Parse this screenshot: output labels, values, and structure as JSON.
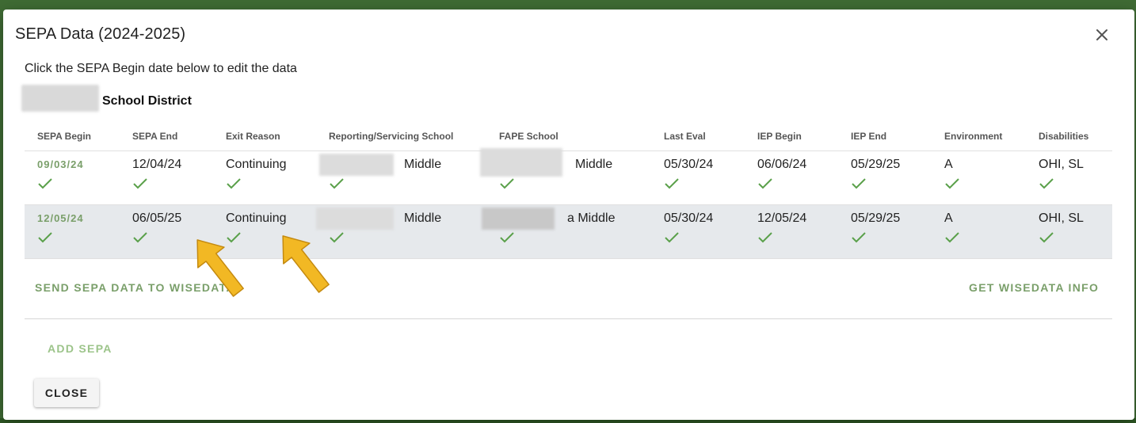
{
  "dialog": {
    "title": "SEPA Data (2024-2025)",
    "instructions": "Click the SEPA Begin date below to edit the data",
    "district_label": "School District"
  },
  "table": {
    "headers": [
      "SEPA Begin",
      "SEPA End",
      "Exit Reason",
      "Reporting/Servicing School",
      "FAPE School",
      "Last Eval",
      "IEP Begin",
      "IEP End",
      "Environment",
      "Disabilities"
    ],
    "rows": [
      {
        "sepa_begin": "09/03/24",
        "sepa_end": "12/04/24",
        "exit_reason": "Continuing",
        "reporting_school": "Middle",
        "fape_school": "Middle",
        "last_eval": "05/30/24",
        "iep_begin": "06/06/24",
        "iep_end": "05/29/25",
        "environment": "A",
        "disabilities": "OHI, SL"
      },
      {
        "sepa_begin": "12/05/24",
        "sepa_end": "06/05/25",
        "exit_reason": "Continuing",
        "reporting_school": "Middle",
        "fape_school": "a Middle",
        "last_eval": "05/30/24",
        "iep_begin": "12/05/24",
        "iep_end": "05/29/25",
        "environment": "A",
        "disabilities": "OHI, SL"
      }
    ]
  },
  "actions": {
    "send": "SEND SEPA DATA TO WISEDATA",
    "get_info": "GET WISEDATA INFO",
    "add": "ADD SEPA",
    "close": "CLOSE"
  },
  "icons": {
    "close": "close-icon",
    "check": "check-icon",
    "arrow": "arrow-annotation-icon"
  },
  "colors": {
    "accent": "#7a9f6a",
    "check": "#5aa04a",
    "arrow": "#f2b824",
    "selected_row": "#e6e9ec",
    "backdrop": "#3f6b34"
  }
}
